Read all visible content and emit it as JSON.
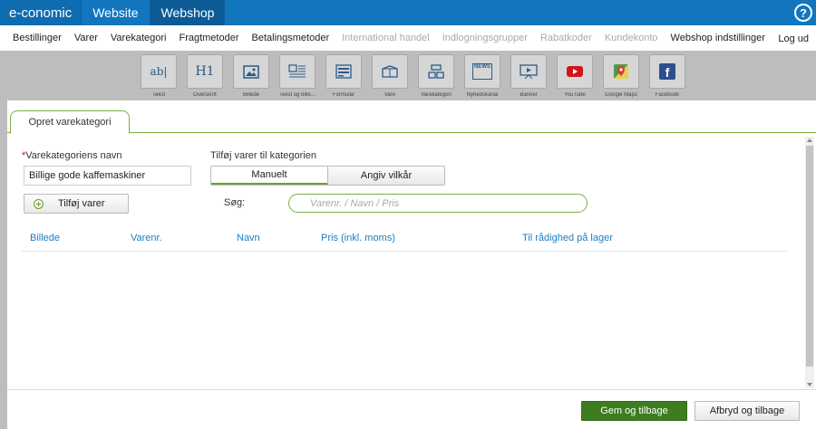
{
  "topbar": {
    "brand": "e-conomic",
    "tabs": [
      {
        "label": "Website",
        "active": false
      },
      {
        "label": "Webshop",
        "active": true
      }
    ],
    "help_label": "?"
  },
  "subnav": {
    "items": [
      {
        "label": "Bestillinger",
        "disabled": false
      },
      {
        "label": "Varer",
        "disabled": false
      },
      {
        "label": "Varekategori",
        "disabled": false
      },
      {
        "label": "Fragtmetoder",
        "disabled": false
      },
      {
        "label": "Betalingsmetoder",
        "disabled": false
      },
      {
        "label": "International handel",
        "disabled": true
      },
      {
        "label": "Indlogningsgrupper",
        "disabled": true
      },
      {
        "label": "Rabatkoder",
        "disabled": true
      },
      {
        "label": "Kundekonto",
        "disabled": true
      },
      {
        "label": "Webshop indstillinger",
        "disabled": false
      }
    ],
    "logout": "Log ud"
  },
  "toolbox": {
    "tools": [
      {
        "label": "Tekst",
        "icon": "text-icon",
        "glyph": "ab|"
      },
      {
        "label": "Overskrift",
        "icon": "heading-icon",
        "glyph": "H1"
      },
      {
        "label": "Billede",
        "icon": "image-icon",
        "glyph": ""
      },
      {
        "label": "Tekst og bille...",
        "icon": "text-image-icon",
        "glyph": ""
      },
      {
        "label": "Formular",
        "icon": "form-icon",
        "glyph": ""
      },
      {
        "label": "Vare",
        "icon": "product-box-icon",
        "glyph": ""
      },
      {
        "label": "Varekategori",
        "icon": "category-icon",
        "glyph": ""
      },
      {
        "label": "Nyhedskanal",
        "icon": "news-icon",
        "glyph": "NEWS"
      },
      {
        "label": "Banner",
        "icon": "banner-icon",
        "glyph": ""
      },
      {
        "label": "YouTube",
        "icon": "youtube-icon",
        "glyph": ""
      },
      {
        "label": "Google Maps",
        "icon": "google-maps-icon",
        "glyph": ""
      },
      {
        "label": "Facebook",
        "icon": "facebook-icon",
        "glyph": "f"
      }
    ]
  },
  "modal": {
    "tab_label": "Opret varekategori",
    "name_label": "Varekategoriens navn",
    "required_mark": "*",
    "name_value": "Billige gode kaffemaskiner",
    "add_products_label": "Tilføj varer til kategorien",
    "mode_buttons": [
      "Manuelt",
      "Angiv vilkår"
    ],
    "add_button": "Tilføj varer",
    "search_label": "Søg:",
    "search_placeholder": "Varenr. / Navn / Pris",
    "columns": [
      "Billede",
      "Varenr.",
      "Navn",
      "Pris (inkl. moms)",
      "Til rådighed på lager"
    ],
    "save_button": "Gem og tilbage",
    "cancel_button": "Afbryd og tilbage"
  },
  "colors": {
    "topbar_blue": "#1276bf",
    "accent_green": "#7ab03e",
    "primary_green": "#3d7d20",
    "link_blue": "#1a7fc1"
  }
}
